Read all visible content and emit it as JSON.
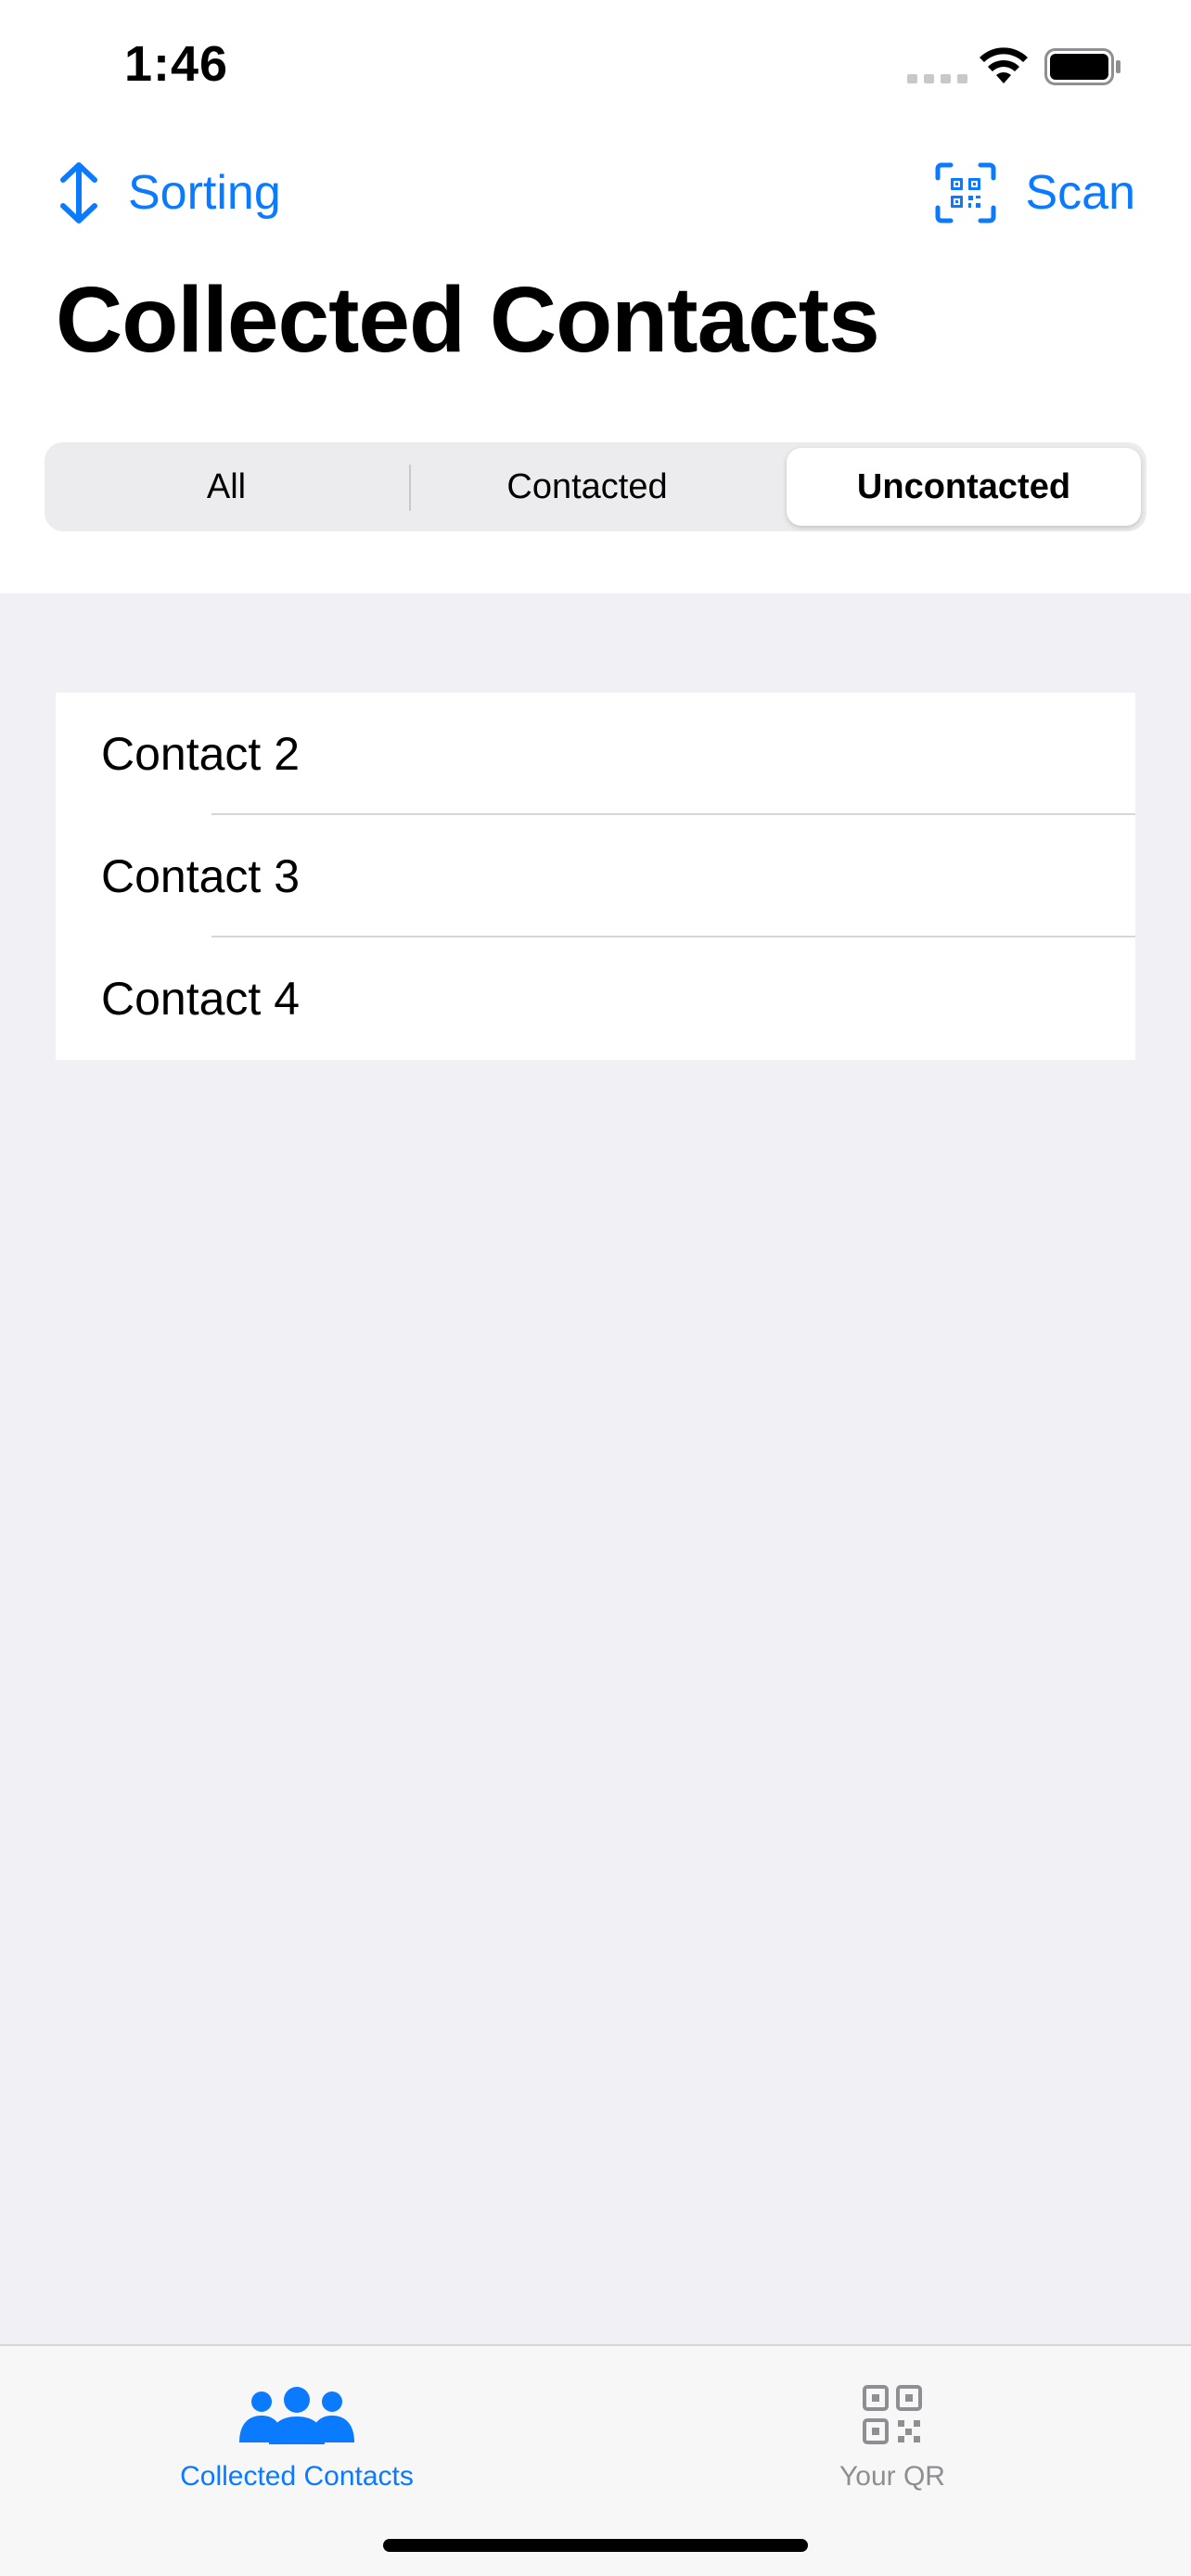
{
  "status_bar": {
    "time": "1:46"
  },
  "nav": {
    "sorting_label": "Sorting",
    "scan_label": "Scan",
    "accent_color": "#0a7aff"
  },
  "page": {
    "title": "Collected Contacts"
  },
  "segments": {
    "items": [
      "All",
      "Contacted",
      "Uncontacted"
    ],
    "selected": "Uncontacted"
  },
  "contacts": [
    "Contact 2",
    "Contact 3",
    "Contact 4"
  ],
  "tabbar": {
    "tabs": [
      {
        "label": "Collected Contacts",
        "icon": "people-icon",
        "active": true
      },
      {
        "label": "Your QR",
        "icon": "qr-code-icon",
        "active": false
      }
    ]
  }
}
